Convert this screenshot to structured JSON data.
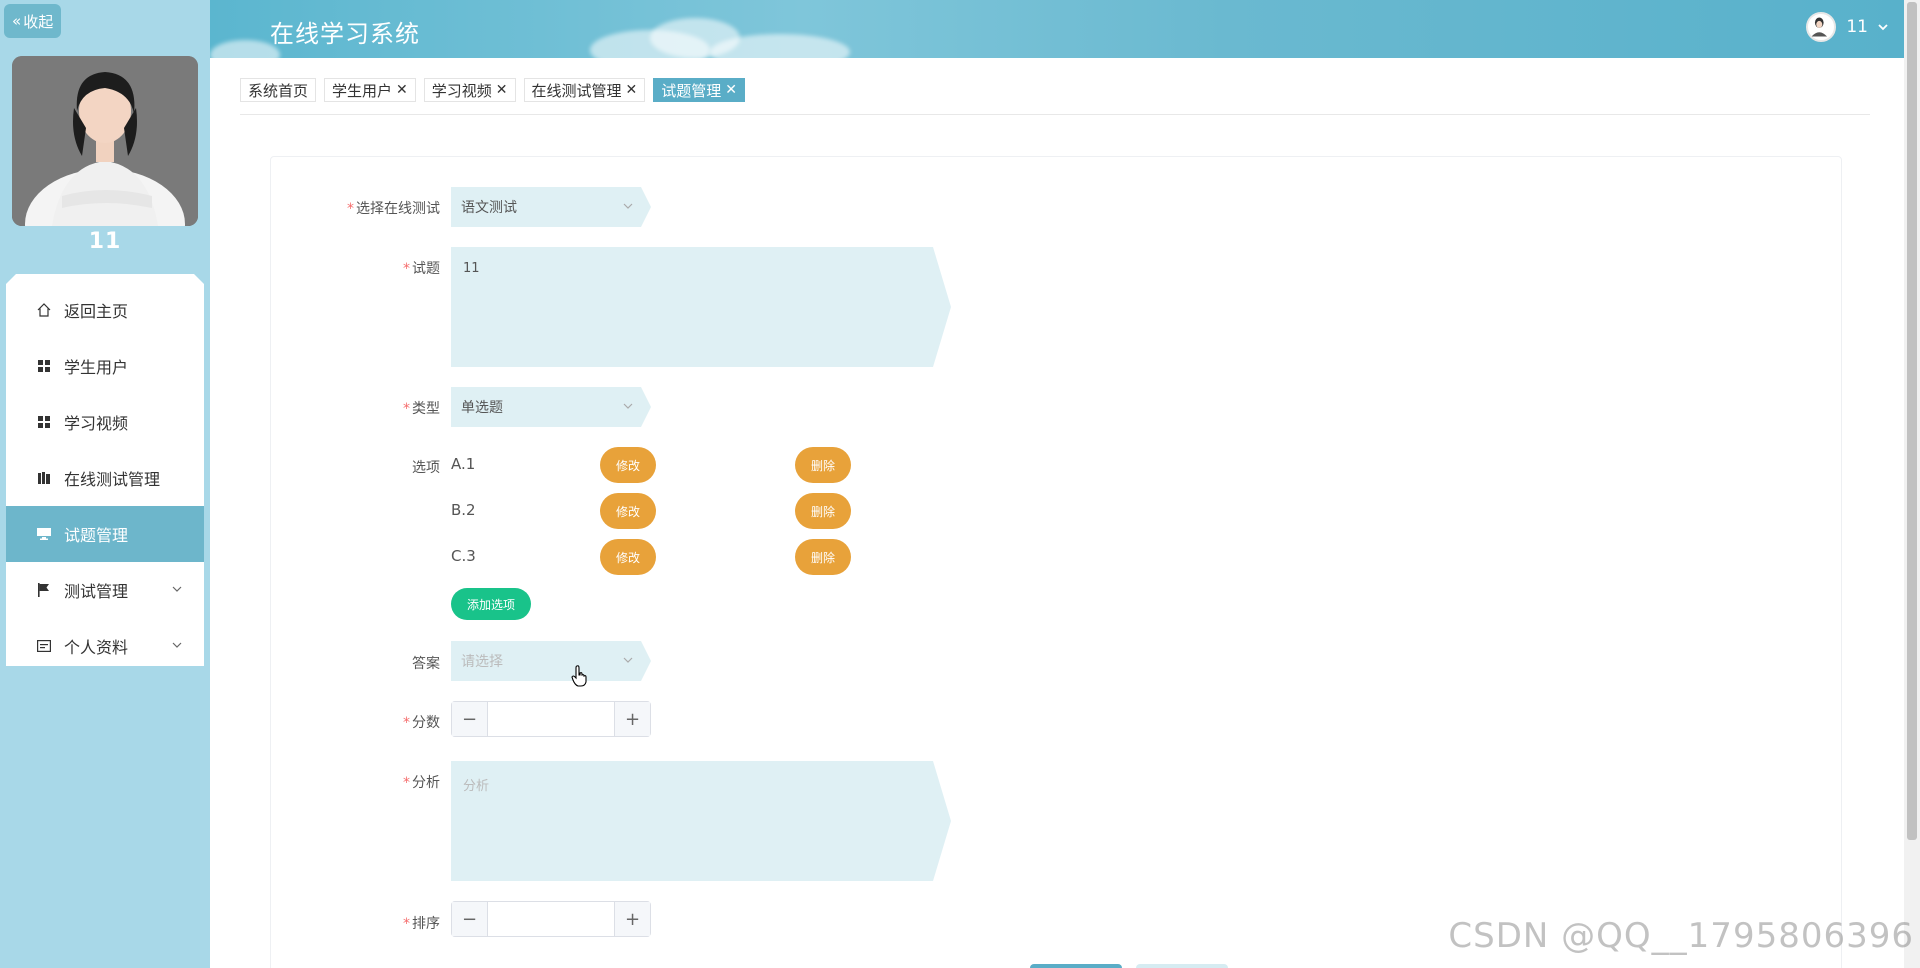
{
  "sidebar": {
    "collapse_label": "收起",
    "user_name": "11",
    "items": [
      {
        "label": "返回主页",
        "icon": "home-icon"
      },
      {
        "label": "学生用户",
        "icon": "grid-icon"
      },
      {
        "label": "学习视频",
        "icon": "grid-icon"
      },
      {
        "label": "在线测试管理",
        "icon": "book-icon"
      },
      {
        "label": "试题管理",
        "icon": "monitor-icon",
        "active": true
      },
      {
        "label": "测试管理",
        "icon": "flag-icon",
        "expandable": true
      },
      {
        "label": "个人资料",
        "icon": "id-card-icon",
        "expandable": true
      }
    ]
  },
  "header": {
    "title": "在线学习系统",
    "user": "11"
  },
  "tabs": [
    {
      "label": "系统首页",
      "closable": false
    },
    {
      "label": "学生用户",
      "closable": true
    },
    {
      "label": "学习视频",
      "closable": true
    },
    {
      "label": "在线测试管理",
      "closable": true
    },
    {
      "label": "试题管理",
      "closable": true,
      "active": true
    }
  ],
  "form": {
    "test_select": {
      "label": "选择在线测试",
      "value": "语文测试"
    },
    "question": {
      "label": "试题",
      "value": "11"
    },
    "type": {
      "label": "类型",
      "value": "单选题"
    },
    "options": {
      "label": "选项",
      "items": [
        "A.1",
        "B.2",
        "C.3"
      ],
      "edit_label": "修改",
      "delete_label": "删除",
      "add_label": "添加选项"
    },
    "answer": {
      "label": "答案",
      "placeholder": "请选择"
    },
    "score": {
      "label": "分数",
      "value": ""
    },
    "analysis": {
      "label": "分析",
      "placeholder": "分析"
    },
    "order": {
      "label": "排序",
      "value": ""
    }
  },
  "watermark": "CSDN @QQ__1795806396",
  "colors": {
    "sidebar_bg": "#a8d8e8",
    "active_item": "#6db6cb",
    "edit_button": "#e8a23a",
    "add_button": "#19c38a",
    "input_bg": "#dff0f4",
    "required": "#f56c6c"
  }
}
